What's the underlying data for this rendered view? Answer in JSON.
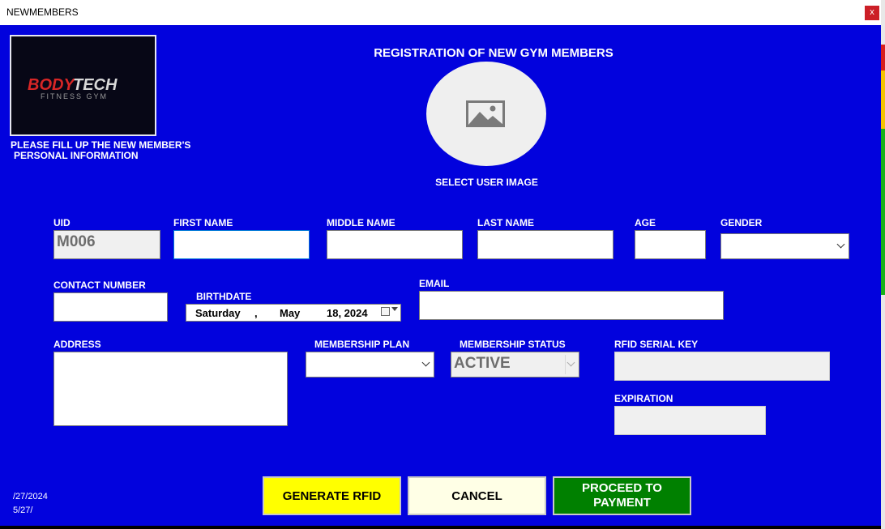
{
  "window": {
    "title": "NEWMEMBERS",
    "close_label": "x"
  },
  "logo": {
    "brand_text": "BODYTECH",
    "sub_text": "FITNESS GYM"
  },
  "instructions": {
    "line1": "PLEASE FILL UP THE NEW MEMBER'S",
    "line2": "PERSONAL INFORMATION"
  },
  "header": {
    "title": "REGISTRATION OF NEW GYM MEMBERS"
  },
  "user_image": {
    "icon": "image-icon",
    "label": "SELECT USER IMAGE"
  },
  "fields": {
    "uid": {
      "label": "UID",
      "value": "M006"
    },
    "first_name": {
      "label": "FIRST NAME",
      "value": ""
    },
    "middle_name": {
      "label": "MIDDLE NAME",
      "value": ""
    },
    "last_name": {
      "label": "LAST NAME",
      "value": ""
    },
    "age": {
      "label": "AGE",
      "value": ""
    },
    "gender": {
      "label": "GENDER",
      "value": ""
    },
    "contact_number": {
      "label": "CONTACT NUMBER",
      "value": ""
    },
    "birthdate": {
      "label": "BIRTHDATE",
      "day": "Saturday",
      "sep": ",",
      "month": "May",
      "date": "18, 2024"
    },
    "email": {
      "label": "EMAIL",
      "value": ""
    },
    "address": {
      "label": "ADDRESS",
      "value": ""
    },
    "membership_plan": {
      "label": "MEMBERSHIP PLAN",
      "value": ""
    },
    "membership_status": {
      "label": "MEMBERSHIP STATUS",
      "value": "ACTIVE"
    },
    "rfid_serial_key": {
      "label": "RFID SERIAL KEY",
      "value": ""
    },
    "expiration": {
      "label": "EXPIRATION",
      "value": ""
    }
  },
  "buttons": {
    "generate_rfid": "GENERATE RFID",
    "cancel": "CANCEL",
    "proceed_line1": "PROCEED TO",
    "proceed_line2": "PAYMENT"
  },
  "footer": {
    "date1": "/27/2024",
    "date2": "5/27/"
  },
  "colors": {
    "form_bg": "#0202dd",
    "generate_btn": "#ffff00",
    "cancel_btn": "#ffffe6",
    "proceed_btn": "#008000"
  }
}
